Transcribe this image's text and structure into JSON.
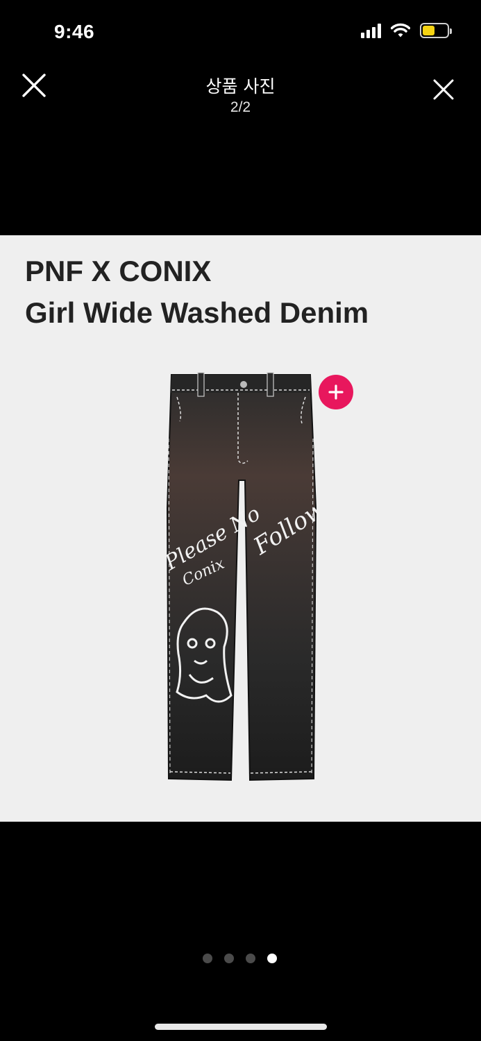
{
  "status_bar": {
    "time": "9:46",
    "battery_level": 0.5,
    "battery_color": "#f5d313"
  },
  "header": {
    "title": "상품 사진",
    "counter": "2/2",
    "left_icon": "close-icon",
    "right_icon": "close-icon"
  },
  "product": {
    "title_line1": "PNF X CONIX",
    "title_line2": "Girl Wide Washed Denim",
    "print_text_1": "Please No",
    "print_text_2": "Conix",
    "print_text_3": "Follow",
    "add_icon": "plus-icon",
    "accent_color": "#e8175d"
  },
  "pagination": {
    "total": 4,
    "active_index": 3
  }
}
